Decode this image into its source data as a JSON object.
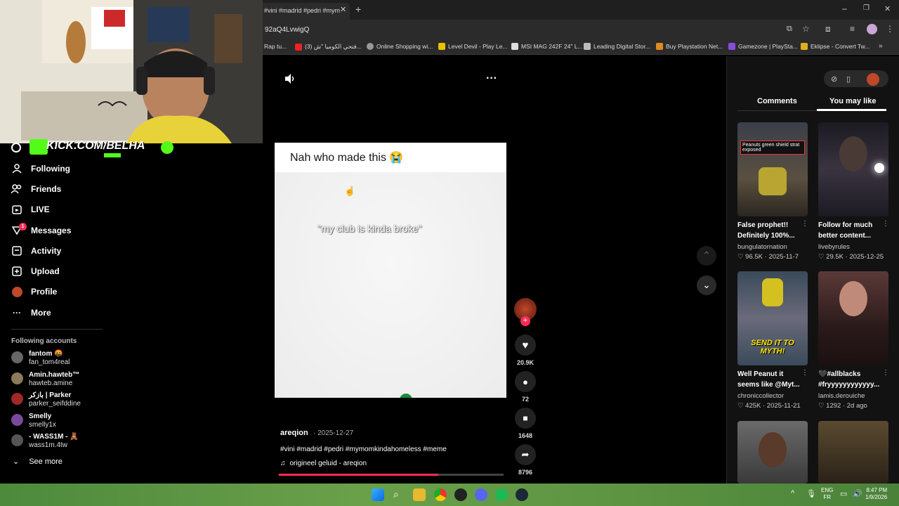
{
  "browser": {
    "tab_title": "#vini #madrid #pedri #mym",
    "url": "92aQ4LvwigQ",
    "bookmarks": [
      "Rap tu...",
      "(3) فتحي الكوميا \"ش...",
      "Online Shopping wi...",
      "Level Devil - Play Le...",
      "MSI MAG 242F 24\" L...",
      "Leading Digital Stor...",
      "Buy Playstation Net...",
      "Gamezone | PlaySta...",
      "Eklipse - Convert Tw..."
    ]
  },
  "stream_overlay": {
    "channel": "KICK.COM/BELHA"
  },
  "nav": {
    "items": [
      {
        "label": "Following",
        "icon": "person-icon"
      },
      {
        "label": "Friends",
        "icon": "friends-icon"
      },
      {
        "label": "LIVE",
        "icon": "live-icon"
      },
      {
        "label": "Messages",
        "icon": "messages-icon",
        "badge": "1"
      },
      {
        "label": "Activity",
        "icon": "activity-icon"
      },
      {
        "label": "Upload",
        "icon": "upload-icon"
      },
      {
        "label": "Profile",
        "icon": "profile-icon"
      },
      {
        "label": "More",
        "icon": "more-icon"
      }
    ],
    "following_heading": "Following accounts",
    "accounts": [
      {
        "name": "fantom 🤬",
        "handle": "fan_tom4real"
      },
      {
        "name": "Amin.hawteb™",
        "handle": "hawteb.amine"
      },
      {
        "name": "بازكر | Parker",
        "handle": "parker_seifddine"
      },
      {
        "name": "Smelly",
        "handle": "smelly1x"
      },
      {
        "name": "- WASS1M - 🧸",
        "handle": "wass1m.4tw"
      }
    ],
    "see_more": "See more"
  },
  "video": {
    "title_text": "Nah who made this 😭",
    "caption_overlay": "\"my club is kinda broke\"",
    "author": "areqion",
    "date": "· 2025-12-27",
    "hashtags": "#vini #madrid #pedri #mymomkindahomeless #meme",
    "sound": "origineel geluid - areqion",
    "progress": 0.71
  },
  "actions": {
    "likes": "20.9K",
    "comments": "72",
    "saves": "1648",
    "shares": "8796"
  },
  "rightpanel": {
    "tabs": [
      "Comments",
      "You may like"
    ],
    "active_tab": "You may like",
    "cards": [
      {
        "title": "False prophet!! Definitely 100%...",
        "user": "bungulatornation",
        "views": "96.5K",
        "date": "· 2025-11-7",
        "thumb_text": "Peanuts green shield strat exposed"
      },
      {
        "title": "Follow for much better content...",
        "user": "livebyrules",
        "views": "29.5K",
        "date": "· 2025-12-25",
        "thumb_text": ""
      },
      {
        "title": "Well Peanut it seems like @Myt...",
        "user": "chroniccollector",
        "views": "425K",
        "date": "· 2025-11-21",
        "thumb_text": "SEND IT TO MYTH!"
      },
      {
        "title": "🖤#allblacks #fryyyyyyyyyyyy...",
        "user": "lamis.derouiche",
        "views": "1292",
        "date": "· 2d ago",
        "thumb_text": ""
      }
    ]
  },
  "taskbar": {
    "lang1": "ENG",
    "lang2": "FR",
    "time": "8:47 PM",
    "date": "1/9/2026"
  }
}
